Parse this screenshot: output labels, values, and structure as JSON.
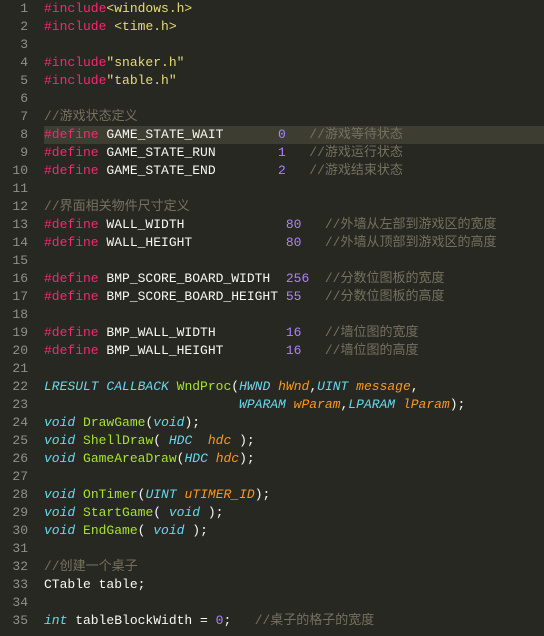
{
  "editor": {
    "active_line": 8,
    "lines": [
      [
        {
          "t": "dir",
          "v": "#include"
        },
        {
          "t": "str",
          "v": "<windows.h>"
        }
      ],
      [
        {
          "t": "dir",
          "v": "#include"
        },
        {
          "t": "plain",
          "v": " "
        },
        {
          "t": "str",
          "v": "<time.h>"
        }
      ],
      [],
      [
        {
          "t": "dir",
          "v": "#include"
        },
        {
          "t": "str",
          "v": "\"snaker.h\""
        }
      ],
      [
        {
          "t": "dir",
          "v": "#include"
        },
        {
          "t": "str",
          "v": "\"table.h\""
        }
      ],
      [],
      [
        {
          "t": "cmt",
          "v": "//游戏状态定义"
        }
      ],
      [
        {
          "t": "dir",
          "v": "#define"
        },
        {
          "t": "plain",
          "v": " GAME_STATE_WAIT       "
        },
        {
          "t": "num",
          "v": "0"
        },
        {
          "t": "plain",
          "v": "   "
        },
        {
          "t": "cmt",
          "v": "//游戏等待状态"
        }
      ],
      [
        {
          "t": "dir",
          "v": "#define"
        },
        {
          "t": "plain",
          "v": " GAME_STATE_RUN        "
        },
        {
          "t": "num",
          "v": "1"
        },
        {
          "t": "plain",
          "v": "   "
        },
        {
          "t": "cmt",
          "v": "//游戏运行状态"
        }
      ],
      [
        {
          "t": "dir",
          "v": "#define"
        },
        {
          "t": "plain",
          "v": " GAME_STATE_END        "
        },
        {
          "t": "num",
          "v": "2"
        },
        {
          "t": "plain",
          "v": "   "
        },
        {
          "t": "cmt",
          "v": "//游戏结束状态"
        }
      ],
      [],
      [
        {
          "t": "cmt",
          "v": "//界面相关物件尺寸定义"
        }
      ],
      [
        {
          "t": "dir",
          "v": "#define"
        },
        {
          "t": "plain",
          "v": " WALL_WIDTH             "
        },
        {
          "t": "num",
          "v": "80"
        },
        {
          "t": "plain",
          "v": "   "
        },
        {
          "t": "cmt",
          "v": "//外墙从左部到游戏区的宽度"
        }
      ],
      [
        {
          "t": "dir",
          "v": "#define"
        },
        {
          "t": "plain",
          "v": " WALL_HEIGHT            "
        },
        {
          "t": "num",
          "v": "80"
        },
        {
          "t": "plain",
          "v": "   "
        },
        {
          "t": "cmt",
          "v": "//外墙从顶部到游戏区的高度"
        }
      ],
      [],
      [
        {
          "t": "dir",
          "v": "#define"
        },
        {
          "t": "plain",
          "v": " BMP_SCORE_BOARD_WIDTH  "
        },
        {
          "t": "num",
          "v": "256"
        },
        {
          "t": "plain",
          "v": "  "
        },
        {
          "t": "cmt",
          "v": "//分数位图板的宽度"
        }
      ],
      [
        {
          "t": "dir",
          "v": "#define"
        },
        {
          "t": "plain",
          "v": " BMP_SCORE_BOARD_HEIGHT "
        },
        {
          "t": "num",
          "v": "55"
        },
        {
          "t": "plain",
          "v": "   "
        },
        {
          "t": "cmt",
          "v": "//分数位图板的高度"
        }
      ],
      [],
      [
        {
          "t": "dir",
          "v": "#define"
        },
        {
          "t": "plain",
          "v": " BMP_WALL_WIDTH         "
        },
        {
          "t": "num",
          "v": "16"
        },
        {
          "t": "plain",
          "v": "   "
        },
        {
          "t": "cmt",
          "v": "//墙位图的宽度"
        }
      ],
      [
        {
          "t": "dir",
          "v": "#define"
        },
        {
          "t": "plain",
          "v": " BMP_WALL_HEIGHT        "
        },
        {
          "t": "num",
          "v": "16"
        },
        {
          "t": "plain",
          "v": "   "
        },
        {
          "t": "cmt",
          "v": "//墙位图的高度"
        }
      ],
      [],
      [
        {
          "t": "kw",
          "v": "LRESULT"
        },
        {
          "t": "plain",
          "v": " "
        },
        {
          "t": "kw",
          "v": "CALLBACK"
        },
        {
          "t": "plain",
          "v": " "
        },
        {
          "t": "fn",
          "v": "WndProc"
        },
        {
          "t": "plain",
          "v": "("
        },
        {
          "t": "kw",
          "v": "HWND"
        },
        {
          "t": "plain",
          "v": " "
        },
        {
          "t": "param",
          "v": "hWnd"
        },
        {
          "t": "plain",
          "v": ","
        },
        {
          "t": "kw",
          "v": "UINT"
        },
        {
          "t": "plain",
          "v": " "
        },
        {
          "t": "param",
          "v": "message"
        },
        {
          "t": "plain",
          "v": ","
        }
      ],
      [
        {
          "t": "plain",
          "v": "                         "
        },
        {
          "t": "kw",
          "v": "WPARAM"
        },
        {
          "t": "plain",
          "v": " "
        },
        {
          "t": "param",
          "v": "wParam"
        },
        {
          "t": "plain",
          "v": ","
        },
        {
          "t": "kw",
          "v": "LPARAM"
        },
        {
          "t": "plain",
          "v": " "
        },
        {
          "t": "param",
          "v": "lParam"
        },
        {
          "t": "plain",
          "v": ");"
        }
      ],
      [
        {
          "t": "kw",
          "v": "void"
        },
        {
          "t": "plain",
          "v": " "
        },
        {
          "t": "fn",
          "v": "DrawGame"
        },
        {
          "t": "plain",
          "v": "("
        },
        {
          "t": "kw",
          "v": "void"
        },
        {
          "t": "plain",
          "v": ");"
        }
      ],
      [
        {
          "t": "kw",
          "v": "void"
        },
        {
          "t": "plain",
          "v": " "
        },
        {
          "t": "fn",
          "v": "ShellDraw"
        },
        {
          "t": "plain",
          "v": "( "
        },
        {
          "t": "kw",
          "v": "HDC"
        },
        {
          "t": "plain",
          "v": "  "
        },
        {
          "t": "param",
          "v": "hdc"
        },
        {
          "t": "plain",
          "v": " );"
        }
      ],
      [
        {
          "t": "kw",
          "v": "void"
        },
        {
          "t": "plain",
          "v": " "
        },
        {
          "t": "fn",
          "v": "GameAreaDraw"
        },
        {
          "t": "plain",
          "v": "("
        },
        {
          "t": "kw",
          "v": "HDC"
        },
        {
          "t": "plain",
          "v": " "
        },
        {
          "t": "param",
          "v": "hdc"
        },
        {
          "t": "plain",
          "v": ");"
        }
      ],
      [],
      [
        {
          "t": "kw",
          "v": "void"
        },
        {
          "t": "plain",
          "v": " "
        },
        {
          "t": "fn",
          "v": "OnTimer"
        },
        {
          "t": "plain",
          "v": "("
        },
        {
          "t": "kw",
          "v": "UINT"
        },
        {
          "t": "plain",
          "v": " "
        },
        {
          "t": "param",
          "v": "uTIMER_ID"
        },
        {
          "t": "plain",
          "v": ");"
        }
      ],
      [
        {
          "t": "kw",
          "v": "void"
        },
        {
          "t": "plain",
          "v": " "
        },
        {
          "t": "fn",
          "v": "StartGame"
        },
        {
          "t": "plain",
          "v": "( "
        },
        {
          "t": "kw",
          "v": "void"
        },
        {
          "t": "plain",
          "v": " );"
        }
      ],
      [
        {
          "t": "kw",
          "v": "void"
        },
        {
          "t": "plain",
          "v": " "
        },
        {
          "t": "fn",
          "v": "EndGame"
        },
        {
          "t": "plain",
          "v": "( "
        },
        {
          "t": "kw",
          "v": "void"
        },
        {
          "t": "plain",
          "v": " );"
        }
      ],
      [],
      [
        {
          "t": "cmt",
          "v": "//创建一个桌子"
        }
      ],
      [
        {
          "t": "plain",
          "v": "CTable table;"
        }
      ],
      [],
      [
        {
          "t": "kw",
          "v": "int"
        },
        {
          "t": "plain",
          "v": " tableBlockWidth "
        },
        {
          "t": "plain",
          "v": "="
        },
        {
          "t": "plain",
          "v": " "
        },
        {
          "t": "num",
          "v": "0"
        },
        {
          "t": "plain",
          "v": ";   "
        },
        {
          "t": "cmt",
          "v": "//桌子的格子的宽度"
        }
      ]
    ]
  }
}
